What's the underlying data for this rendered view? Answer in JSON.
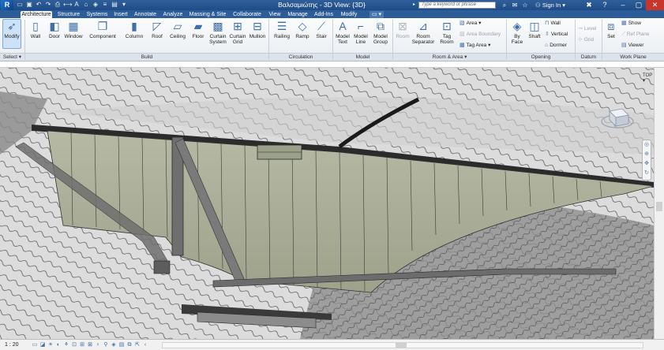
{
  "app": {
    "logo": "R",
    "title": "Βαλσαμιώτης - 3D View: {3D}",
    "search_placeholder": "Type a keyword or phrase",
    "signin": "Sign In",
    "window_controls": [
      "minimize-icon",
      "maximize-icon",
      "close-icon"
    ]
  },
  "quick_access": [
    "open-icon",
    "save-icon",
    "undo-icon",
    "redo-icon",
    "print-icon",
    "measure-icon",
    "text-icon",
    "3d-view-icon",
    "section-icon",
    "thin-lines-icon",
    "close-hidden-icon",
    "switch-windows-icon"
  ],
  "tabs": [
    {
      "label": "Architecture",
      "active": true
    },
    {
      "label": "Structure",
      "active": false
    },
    {
      "label": "Systems",
      "active": false
    },
    {
      "label": "Insert",
      "active": false
    },
    {
      "label": "Annotate",
      "active": false
    },
    {
      "label": "Analyze",
      "active": false
    },
    {
      "label": "Massing & Site",
      "active": false
    },
    {
      "label": "Collaborate",
      "active": false
    },
    {
      "label": "View",
      "active": false
    },
    {
      "label": "Manage",
      "active": false
    },
    {
      "label": "Add-Ins",
      "active": false
    },
    {
      "label": "Modify",
      "active": false
    }
  ],
  "ribbon": {
    "select": {
      "modify": "Modify",
      "panel": "Select ▾"
    },
    "build": {
      "wall": "Wall",
      "door": "Door",
      "window": "Window",
      "component": "Component",
      "column": "Column",
      "roof": "Roof",
      "ceiling": "Ceiling",
      "floor": "Floor",
      "curtain_system_1": "Curtain",
      "curtain_system_2": "System",
      "curtain_grid_1": "Curtain",
      "curtain_grid_2": "Grid",
      "mullion": "Mullion",
      "panel": "Build"
    },
    "circulation": {
      "railing": "Railing",
      "ramp": "Ramp",
      "stair": "Stair",
      "panel": "Circulation"
    },
    "model": {
      "model_text_1": "Model",
      "model_text_2": "Text",
      "model_line_1": "Model",
      "model_line_2": "Line",
      "model_group_1": "Model",
      "model_group_2": "Group",
      "panel": "Model"
    },
    "room_area": {
      "room": "Room",
      "room_sep_1": "Room",
      "room_sep_2": "Separator",
      "tag_room_1": "Tag",
      "tag_room_2": "Room",
      "area": "Area ▾",
      "area_boundary": "Area Boundary",
      "tag_area": "Tag Area ▾",
      "panel": "Room & Area ▾"
    },
    "opening": {
      "by_face_1": "By",
      "by_face_2": "Face",
      "shaft": "Shaft",
      "wall": "Wall",
      "vertical": "Vertical",
      "dormer": "Dormer",
      "panel": "Opening"
    },
    "datum": {
      "level": "Level",
      "grid": "Grid",
      "panel": "Datum"
    },
    "work_plane": {
      "set": "Set",
      "show": "Show",
      "ref_plane": "Ref Plane",
      "viewer": "Viewer",
      "panel": "Work Plane"
    }
  },
  "viewcube": {
    "label": "TOP ▾"
  },
  "statusbar": {
    "scale": "1 : 20"
  }
}
